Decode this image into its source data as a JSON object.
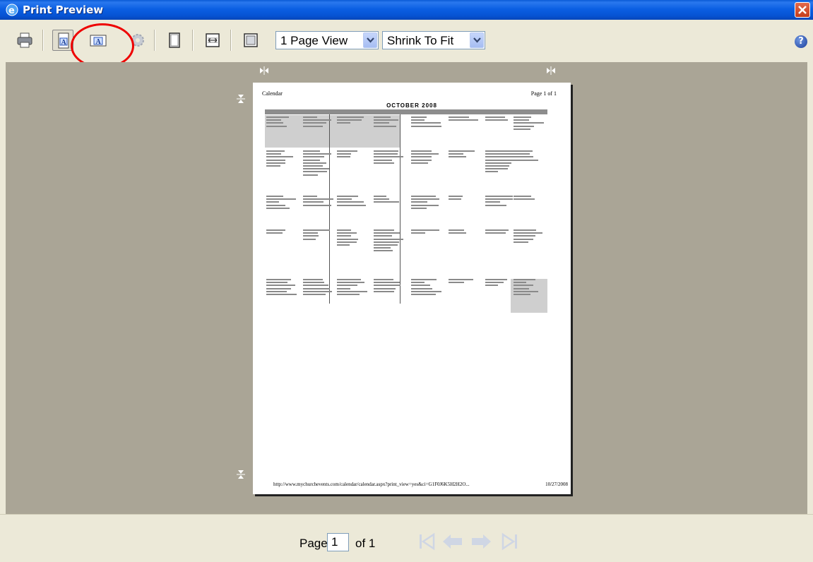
{
  "window": {
    "title": "Print Preview"
  },
  "toolbar": {
    "view_select_value": "1 Page View",
    "zoom_select_value": "Shrink To Fit"
  },
  "page_preview": {
    "header_left": "Calendar",
    "header_right": "Page 1 of 1",
    "calendar_title": "OCTOBER 2008",
    "footer_url": "http://www.mychurchevents.com/calendar/calendar.aspx?print_view=yes&ci=G1F0J6K5H2H2O...",
    "footer_date": "10/27/2008"
  },
  "statusbar": {
    "page_label": "Page",
    "page_value": "1",
    "of_label": "of 1"
  },
  "colors": {
    "titlebar": "#0b5fe3",
    "stage_bg": "#aaa596",
    "annotation": "#e00000"
  }
}
